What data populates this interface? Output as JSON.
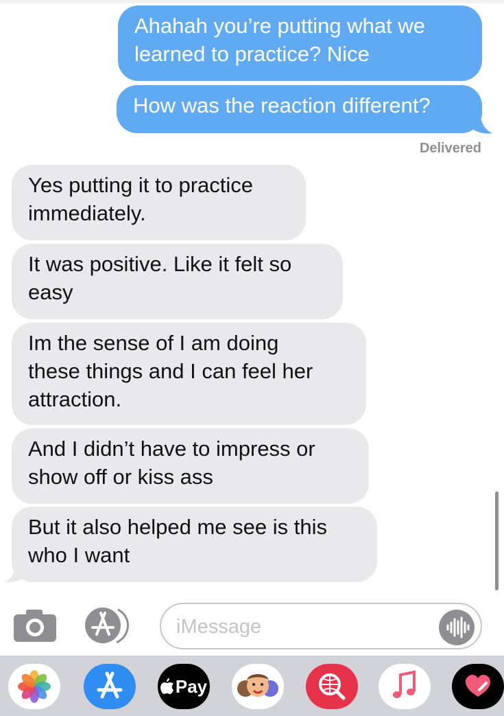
{
  "conversation": {
    "sent_messages": [
      "Ahahah you’re putting what we\nlearned to practice? Nice",
      "How was the reaction different?"
    ],
    "delivered_status": "Delivered",
    "received_messages": [
      "Yes putting it to practice\nimmediately.",
      "It was positive. Like it felt so\neasy",
      "Im the sense of I am doing\nthese things and I can feel her\nattraction.",
      "And I didn’t have to impress or\nshow off or kiss ass",
      "But it also helped me see is this\nwho I want"
    ]
  },
  "input_bar": {
    "placeholder": "iMessage",
    "camera_icon": "camera-icon",
    "apps_icon": "app-store-icon",
    "audio_icon": "audio-waveform-icon"
  },
  "app_drawer": {
    "apple_pay_label": "Pay",
    "apps": [
      "photos-icon",
      "app-store-icon",
      "apple-pay-icon",
      "memoji-icon",
      "web-search-icon",
      "music-icon",
      "digital-touch-icon"
    ]
  },
  "colors": {
    "sent_bubble": "#60aaf4",
    "received_bubble": "#e9e9eb",
    "drawer_background": "#d1d3d9"
  }
}
